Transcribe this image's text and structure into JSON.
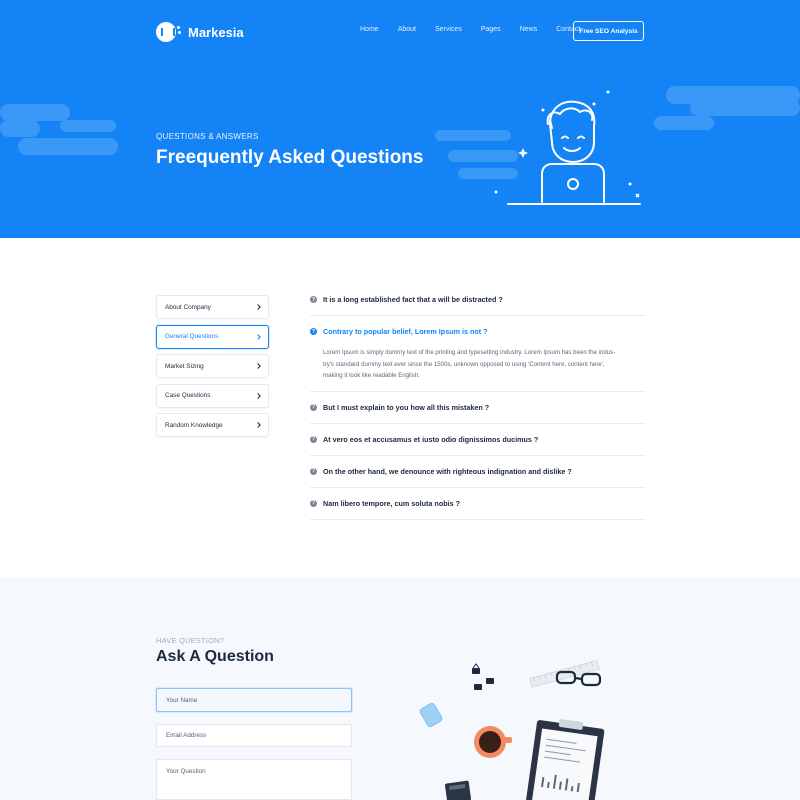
{
  "brand": {
    "name": "Markesia"
  },
  "nav": {
    "items": [
      "Home",
      "About",
      "Services",
      "Pages",
      "News",
      "Contact"
    ],
    "cta": "Free SEO Analysis"
  },
  "hero": {
    "subtitle": "QUESTIONS & ANSWERS",
    "title": "Freequently Asked Questions"
  },
  "sidebar": {
    "items": [
      {
        "label": "About Company",
        "active": false
      },
      {
        "label": "General Questions",
        "active": true
      },
      {
        "label": "Market Sizing",
        "active": false
      },
      {
        "label": "Case Questions",
        "active": false
      },
      {
        "label": "Random Knowledge",
        "active": false
      }
    ]
  },
  "faq": {
    "items": [
      {
        "question": "It is a long established fact that a will be distracted ?",
        "open": false
      },
      {
        "question": "Contrary to popular belief, Lorem Ipsum is not ?",
        "open": true,
        "answer": [
          "Lorem Ipsum is simply dummy text of the printing and typesetting industry. Lorem Ipsum has been the indus-",
          "try's standard dummy text ever since the 1500s, unknown opposed to using 'Content here, content here',",
          "making it look like readable English."
        ]
      },
      {
        "question": "But I must explain to you how all this mistaken ?",
        "open": false
      },
      {
        "question": "At vero eos et accusamus et iusto odio dignissimos ducimus ?",
        "open": false
      },
      {
        "question": "On the other hand, we denounce with righteous indignation and dislike ?",
        "open": false
      },
      {
        "question": "Nam libero tempore, cum soluta nobis  ?",
        "open": false
      }
    ]
  },
  "ask": {
    "subtitle": "HAVE QUESTION?",
    "title": "Ask A Question",
    "fields": {
      "name_placeholder": "Your Name",
      "email_placeholder": "Email Address",
      "question_placeholder": "Your Question"
    }
  },
  "colors": {
    "accent": "#1483f5",
    "dark": "#1b2a3d",
    "muted": "#5d6a79"
  }
}
